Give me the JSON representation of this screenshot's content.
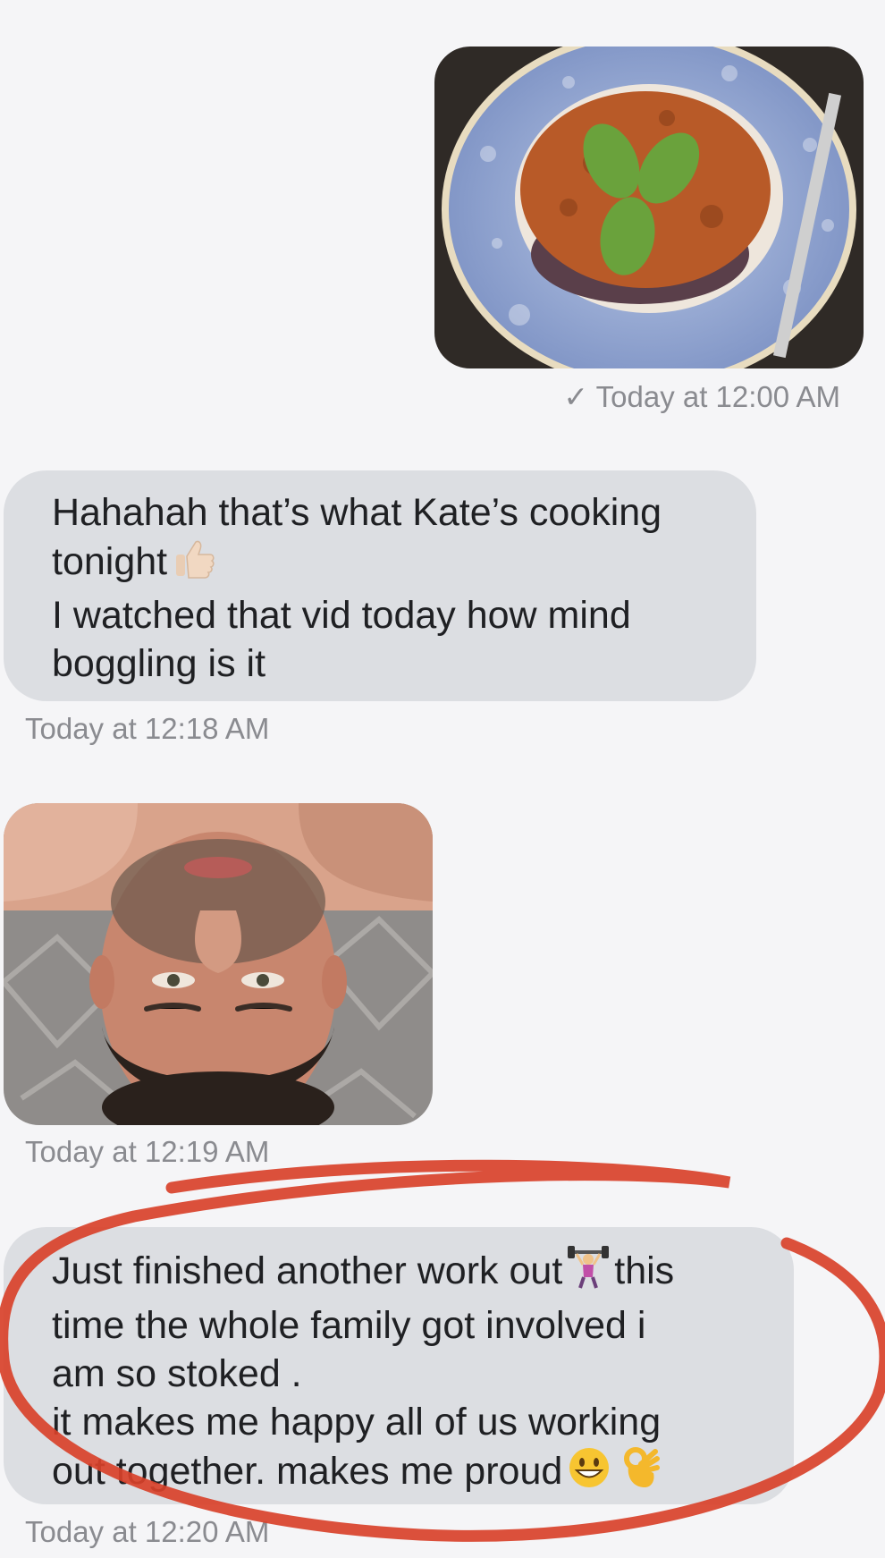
{
  "messages": [
    {
      "id": "msg-1",
      "type": "image",
      "direction": "outgoing",
      "image_description": "plate of bolognese pasta with basil leaves",
      "status_mark": "✓",
      "timestamp": "Today at 12:00 AM"
    },
    {
      "id": "msg-2",
      "type": "text",
      "direction": "incoming",
      "lines": [
        "Hahahah that’s what Kate’s cooking",
        "tonight",
        "I watched that vid today how mind",
        "boggling is it"
      ],
      "emoji": "thumbs-up",
      "timestamp": "Today at 12:18 AM"
    },
    {
      "id": "msg-3",
      "type": "image",
      "direction": "incoming",
      "image_description": "upside-down selfie of a man lying on a rug",
      "timestamp": "Today at 12:19 AM"
    },
    {
      "id": "msg-4",
      "type": "text",
      "direction": "incoming",
      "lines": [
        "Just finished another work out",
        "this",
        "time the whole family got involved i",
        "am so stoked .",
        "it makes me happy all of us working",
        "out together. makes me proud"
      ],
      "emojis": [
        "weight-lifter",
        "grinning-face",
        "ok-hand"
      ],
      "timestamp": "Today at 12:20 AM"
    }
  ],
  "annotation": {
    "type": "hand-drawn-circle",
    "color": "#d8412a"
  },
  "colors": {
    "background": "#f5f5f7",
    "bubble": "#dcdee2",
    "text": "#1f2023",
    "timestamp": "#8a8b90"
  }
}
